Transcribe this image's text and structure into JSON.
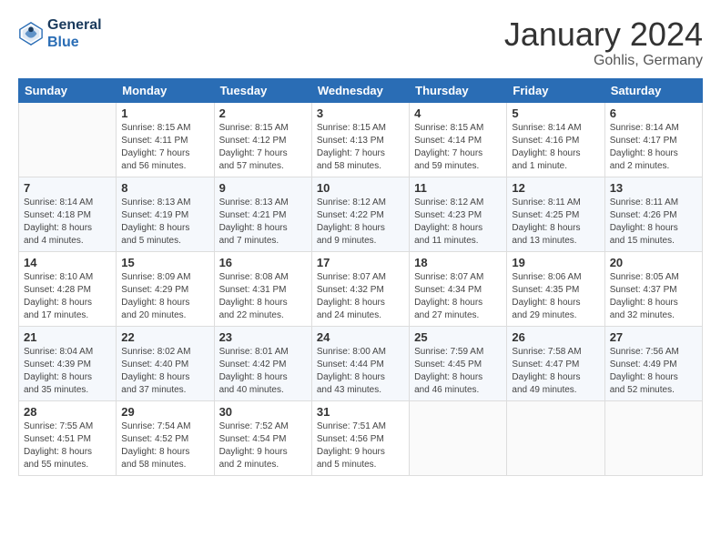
{
  "header": {
    "logo_line1": "General",
    "logo_line2": "Blue",
    "month": "January 2024",
    "location": "Gohlis, Germany"
  },
  "weekdays": [
    "Sunday",
    "Monday",
    "Tuesday",
    "Wednesday",
    "Thursday",
    "Friday",
    "Saturday"
  ],
  "weeks": [
    [
      {
        "day": "",
        "info": ""
      },
      {
        "day": "1",
        "info": "Sunrise: 8:15 AM\nSunset: 4:11 PM\nDaylight: 7 hours\nand 56 minutes."
      },
      {
        "day": "2",
        "info": "Sunrise: 8:15 AM\nSunset: 4:12 PM\nDaylight: 7 hours\nand 57 minutes."
      },
      {
        "day": "3",
        "info": "Sunrise: 8:15 AM\nSunset: 4:13 PM\nDaylight: 7 hours\nand 58 minutes."
      },
      {
        "day": "4",
        "info": "Sunrise: 8:15 AM\nSunset: 4:14 PM\nDaylight: 7 hours\nand 59 minutes."
      },
      {
        "day": "5",
        "info": "Sunrise: 8:14 AM\nSunset: 4:16 PM\nDaylight: 8 hours\nand 1 minute."
      },
      {
        "day": "6",
        "info": "Sunrise: 8:14 AM\nSunset: 4:17 PM\nDaylight: 8 hours\nand 2 minutes."
      }
    ],
    [
      {
        "day": "7",
        "info": "Sunrise: 8:14 AM\nSunset: 4:18 PM\nDaylight: 8 hours\nand 4 minutes."
      },
      {
        "day": "8",
        "info": "Sunrise: 8:13 AM\nSunset: 4:19 PM\nDaylight: 8 hours\nand 5 minutes."
      },
      {
        "day": "9",
        "info": "Sunrise: 8:13 AM\nSunset: 4:21 PM\nDaylight: 8 hours\nand 7 minutes."
      },
      {
        "day": "10",
        "info": "Sunrise: 8:12 AM\nSunset: 4:22 PM\nDaylight: 8 hours\nand 9 minutes."
      },
      {
        "day": "11",
        "info": "Sunrise: 8:12 AM\nSunset: 4:23 PM\nDaylight: 8 hours\nand 11 minutes."
      },
      {
        "day": "12",
        "info": "Sunrise: 8:11 AM\nSunset: 4:25 PM\nDaylight: 8 hours\nand 13 minutes."
      },
      {
        "day": "13",
        "info": "Sunrise: 8:11 AM\nSunset: 4:26 PM\nDaylight: 8 hours\nand 15 minutes."
      }
    ],
    [
      {
        "day": "14",
        "info": "Sunrise: 8:10 AM\nSunset: 4:28 PM\nDaylight: 8 hours\nand 17 minutes."
      },
      {
        "day": "15",
        "info": "Sunrise: 8:09 AM\nSunset: 4:29 PM\nDaylight: 8 hours\nand 20 minutes."
      },
      {
        "day": "16",
        "info": "Sunrise: 8:08 AM\nSunset: 4:31 PM\nDaylight: 8 hours\nand 22 minutes."
      },
      {
        "day": "17",
        "info": "Sunrise: 8:07 AM\nSunset: 4:32 PM\nDaylight: 8 hours\nand 24 minutes."
      },
      {
        "day": "18",
        "info": "Sunrise: 8:07 AM\nSunset: 4:34 PM\nDaylight: 8 hours\nand 27 minutes."
      },
      {
        "day": "19",
        "info": "Sunrise: 8:06 AM\nSunset: 4:35 PM\nDaylight: 8 hours\nand 29 minutes."
      },
      {
        "day": "20",
        "info": "Sunrise: 8:05 AM\nSunset: 4:37 PM\nDaylight: 8 hours\nand 32 minutes."
      }
    ],
    [
      {
        "day": "21",
        "info": "Sunrise: 8:04 AM\nSunset: 4:39 PM\nDaylight: 8 hours\nand 35 minutes."
      },
      {
        "day": "22",
        "info": "Sunrise: 8:02 AM\nSunset: 4:40 PM\nDaylight: 8 hours\nand 37 minutes."
      },
      {
        "day": "23",
        "info": "Sunrise: 8:01 AM\nSunset: 4:42 PM\nDaylight: 8 hours\nand 40 minutes."
      },
      {
        "day": "24",
        "info": "Sunrise: 8:00 AM\nSunset: 4:44 PM\nDaylight: 8 hours\nand 43 minutes."
      },
      {
        "day": "25",
        "info": "Sunrise: 7:59 AM\nSunset: 4:45 PM\nDaylight: 8 hours\nand 46 minutes."
      },
      {
        "day": "26",
        "info": "Sunrise: 7:58 AM\nSunset: 4:47 PM\nDaylight: 8 hours\nand 49 minutes."
      },
      {
        "day": "27",
        "info": "Sunrise: 7:56 AM\nSunset: 4:49 PM\nDaylight: 8 hours\nand 52 minutes."
      }
    ],
    [
      {
        "day": "28",
        "info": "Sunrise: 7:55 AM\nSunset: 4:51 PM\nDaylight: 8 hours\nand 55 minutes."
      },
      {
        "day": "29",
        "info": "Sunrise: 7:54 AM\nSunset: 4:52 PM\nDaylight: 8 hours\nand 58 minutes."
      },
      {
        "day": "30",
        "info": "Sunrise: 7:52 AM\nSunset: 4:54 PM\nDaylight: 9 hours\nand 2 minutes."
      },
      {
        "day": "31",
        "info": "Sunrise: 7:51 AM\nSunset: 4:56 PM\nDaylight: 9 hours\nand 5 minutes."
      },
      {
        "day": "",
        "info": ""
      },
      {
        "day": "",
        "info": ""
      },
      {
        "day": "",
        "info": ""
      }
    ]
  ]
}
